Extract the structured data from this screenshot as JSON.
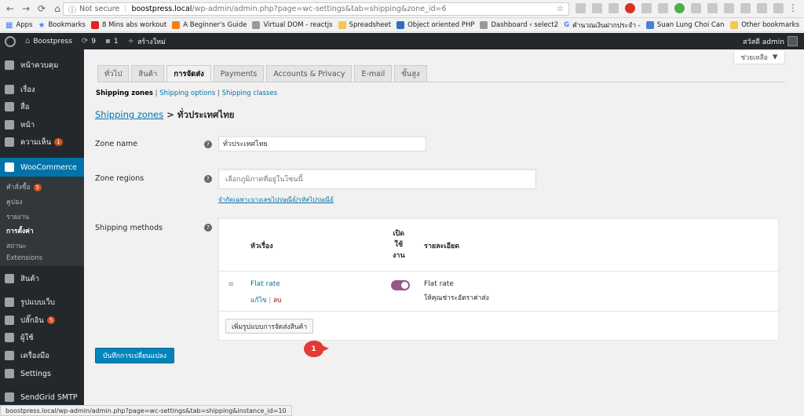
{
  "browser": {
    "security_label": "Not secure",
    "url_host": "boostpress.local",
    "url_path": "/wp-admin/admin.php?page=wc-settings&tab=shipping&zone_id=6",
    "bookmarks": [
      {
        "label": "Apps",
        "icon": "apps-grid-icon"
      },
      {
        "label": "Bookmarks",
        "icon": "star-icon"
      },
      {
        "label": "8 Mins abs workout",
        "icon": "youtube-icon"
      },
      {
        "label": "A Beginner's Guide",
        "icon": "orange-site-icon"
      },
      {
        "label": "Virtual DOM - reactjs",
        "icon": "page-icon"
      },
      {
        "label": "Spreadsheet",
        "icon": "folder-icon"
      },
      {
        "label": "Object oriented PHP",
        "icon": "blue-site-icon"
      },
      {
        "label": "Dashboard ‹ select2",
        "icon": "page-icon"
      },
      {
        "label": "คำนวณเงินฝากประจำ -",
        "icon": "google-icon"
      },
      {
        "label": "Suan Lung Choi Can",
        "icon": "docs-icon"
      }
    ],
    "other_bookmarks": "Other bookmarks",
    "status_url": "boostpress.local/wp-admin/admin.php?page=wc-settings&tab=shipping&instance_id=10"
  },
  "adminbar": {
    "site_name": "Boostpress",
    "updates_count": "9",
    "comments_count": "1",
    "new_label": "สร้างใหม่",
    "howdy": "สวัสดี admin"
  },
  "sidebar": {
    "items": [
      {
        "label": "หน้าควบคุม",
        "icon": "dashboard-icon"
      },
      {
        "label": "เรื่อง",
        "icon": "pin-icon"
      },
      {
        "label": "สื่อ",
        "icon": "media-icon"
      },
      {
        "label": "หน้า",
        "icon": "page-icon"
      },
      {
        "label": "ความเห็น",
        "icon": "comment-icon",
        "badge": "1"
      },
      {
        "label": "WooCommerce",
        "icon": "woocommerce-icon"
      },
      {
        "label": "สินค้า",
        "icon": "product-icon"
      },
      {
        "label": "รูปแบบเว็บ",
        "icon": "appearance-icon"
      },
      {
        "label": "ปลั๊กอิน",
        "icon": "plugin-icon",
        "badge": "5"
      },
      {
        "label": "ผู้ใช้",
        "icon": "users-icon"
      },
      {
        "label": "เครื่องมือ",
        "icon": "tools-icon"
      },
      {
        "label": "Settings",
        "icon": "settings-icon"
      },
      {
        "label": "SendGrid SMTP",
        "icon": "mail-icon"
      }
    ],
    "submenu": [
      {
        "label": "คำสั่งซื้อ",
        "badge": "5"
      },
      {
        "label": "คูปอง"
      },
      {
        "label": "รายงาน"
      },
      {
        "label": "การตั้งค่า"
      },
      {
        "label": "สถานะ"
      },
      {
        "label": "Extensions"
      }
    ]
  },
  "help_button": "ช่วยเหลือ",
  "tabs": [
    "ทั่วไป",
    "สินค้า",
    "การจัดส่ง",
    "Payments",
    "Accounts & Privacy",
    "E-mail",
    "ขั้นสูง"
  ],
  "subsubsub": {
    "current": "Shipping zones",
    "options": "Shipping options",
    "classes": "Shipping classes"
  },
  "breadcrumb": {
    "link": "Shipping zones",
    "arrow": ">",
    "current": "ทั่วประเทศไทย"
  },
  "form": {
    "zone_name_label": "Zone name",
    "zone_name_value": "ทั่วประเทศไทย",
    "zone_regions_label": "Zone regions",
    "zone_regions_placeholder": "เลือกภูมิภาคที่อยู่ในโซนนี้",
    "limit_postcodes_link": "จำกัดเฉพาะบางเลขไปรษณีย์/รหัสไปรษณีย์",
    "shipping_methods_label": "Shipping methods"
  },
  "methods_table": {
    "col_title": "หัวเรื่อง",
    "col_enabled_lines": [
      "เปิด",
      "ใช้",
      "งาน"
    ],
    "col_description": "รายละเอียด",
    "rows": [
      {
        "title": "Flat rate",
        "edit": "แก้ไข",
        "separator": "|",
        "delete": "ลบ",
        "enabled": true,
        "desc_title": "Flat rate",
        "desc": "ให้คุณช่าระอัตราค่าส่ง"
      }
    ],
    "add_button": "เพิ่มรูปแบบการจัดส่งสินค้า"
  },
  "callout_number": "1",
  "save_button": "บันทึกการเปลี่ยนแปลง",
  "colors": {
    "accent": "#0073aa",
    "toggle": "#96588a",
    "callout": "#e53935"
  }
}
